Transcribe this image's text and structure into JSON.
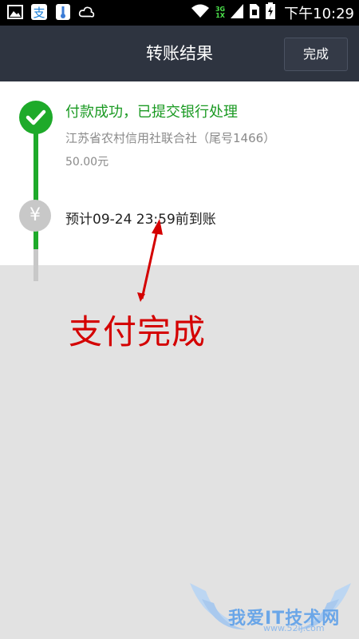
{
  "status_bar": {
    "clock": "下午10:29",
    "net_top": "3G",
    "net_bottom": "1X",
    "left_icons": [
      "image-icon",
      "alipay-icon",
      "thermometer-icon",
      "weather-icon"
    ],
    "right_icons": [
      "wifi-icon",
      "signal-icon",
      "sim-icon",
      "battery-charging-icon"
    ]
  },
  "header": {
    "title": "转账结果",
    "done_label": "完成"
  },
  "result": {
    "status": "付款成功，已提交银行处理",
    "bank": "江苏省农村信用社联合社（尾号1466）",
    "amount": "50.00元",
    "yen_symbol": "¥",
    "eta": "预计09-24 23:59前到账"
  },
  "annotation": {
    "text": "支付完成"
  },
  "watermark": {
    "text": "我爱IT技术网",
    "url": "www.52ij.com"
  },
  "colors": {
    "success_green": "#1eaa2a",
    "header_bg": "#2e3440",
    "annotation_red": "#d40000",
    "pending_gray": "#c8c8c8"
  }
}
